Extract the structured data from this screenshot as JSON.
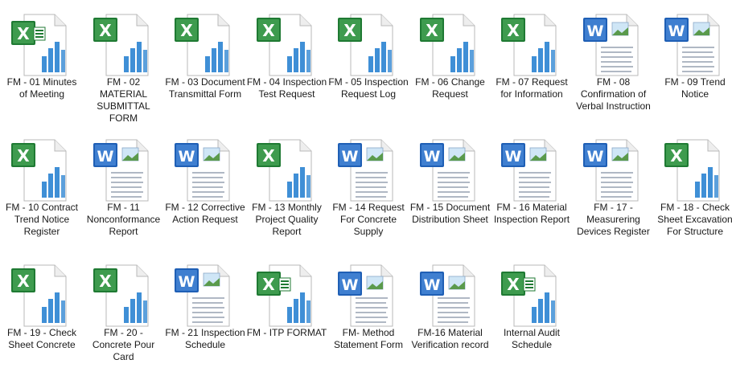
{
  "files": [
    {
      "label": "FM - 01 Minutes of Meeting",
      "type": "excel",
      "variant": "modern"
    },
    {
      "label": "FM - 02 MATERIAL SUBMITTAL FORM",
      "type": "excel",
      "variant": "classic"
    },
    {
      "label": "FM - 03 Document Transmittal Form",
      "type": "excel",
      "variant": "classic"
    },
    {
      "label": "FM - 04 Inspection Test Request",
      "type": "excel",
      "variant": "classic"
    },
    {
      "label": "FM - 05 Inspection Request Log",
      "type": "excel",
      "variant": "classic"
    },
    {
      "label": "FM - 06 Change Request",
      "type": "excel",
      "variant": "classic"
    },
    {
      "label": "FM - 07 Request for Information",
      "type": "excel",
      "variant": "classic"
    },
    {
      "label": "FM - 08 Confirmation of Verbal Instruction",
      "type": "word",
      "variant": "classic"
    },
    {
      "label": "FM - 09 Trend Notice",
      "type": "word",
      "variant": "classic"
    },
    {
      "label": "FM - 10 Contract Trend Notice Register",
      "type": "excel",
      "variant": "classic"
    },
    {
      "label": "FM - 11 Nonconformance Report",
      "type": "word",
      "variant": "classic"
    },
    {
      "label": "FM - 12 Corrective Action Request",
      "type": "word",
      "variant": "classic"
    },
    {
      "label": "FM - 13 Monthly Project Quality Report",
      "type": "excel",
      "variant": "classic"
    },
    {
      "label": "FM - 14 Request For Concrete Supply",
      "type": "word",
      "variant": "classic"
    },
    {
      "label": "FM - 15 Document Distribution Sheet",
      "type": "word",
      "variant": "classic"
    },
    {
      "label": "FM - 16 Material Inspection Report",
      "type": "word",
      "variant": "classic"
    },
    {
      "label": "FM - 17 - Measurering Devices Register",
      "type": "word",
      "variant": "classic"
    },
    {
      "label": "FM - 18 - Check Sheet Excavation For Structure",
      "type": "excel",
      "variant": "classic"
    },
    {
      "label": "FM - 19 - Check Sheet Concrete",
      "type": "excel",
      "variant": "classic"
    },
    {
      "label": "FM - 20 - Concrete Pour Card",
      "type": "excel",
      "variant": "classic"
    },
    {
      "label": "FM - 21 Inspection Schedule",
      "type": "word",
      "variant": "classic"
    },
    {
      "label": "FM - ITP FORMAT",
      "type": "excel",
      "variant": "modern"
    },
    {
      "label": "FM- Method Statement Form",
      "type": "word",
      "variant": "modern"
    },
    {
      "label": "FM-16 Material Verification record",
      "type": "word",
      "variant": "modern"
    },
    {
      "label": "Internal Audit Schedule",
      "type": "excel",
      "variant": "modern"
    }
  ],
  "colors": {
    "excel_green": "#1f7a33",
    "excel_green_light": "#3e9b4e",
    "word_blue": "#1f5fb5",
    "word_blue_light": "#3f7fd0",
    "chart_blue": "#3f8fd6"
  }
}
